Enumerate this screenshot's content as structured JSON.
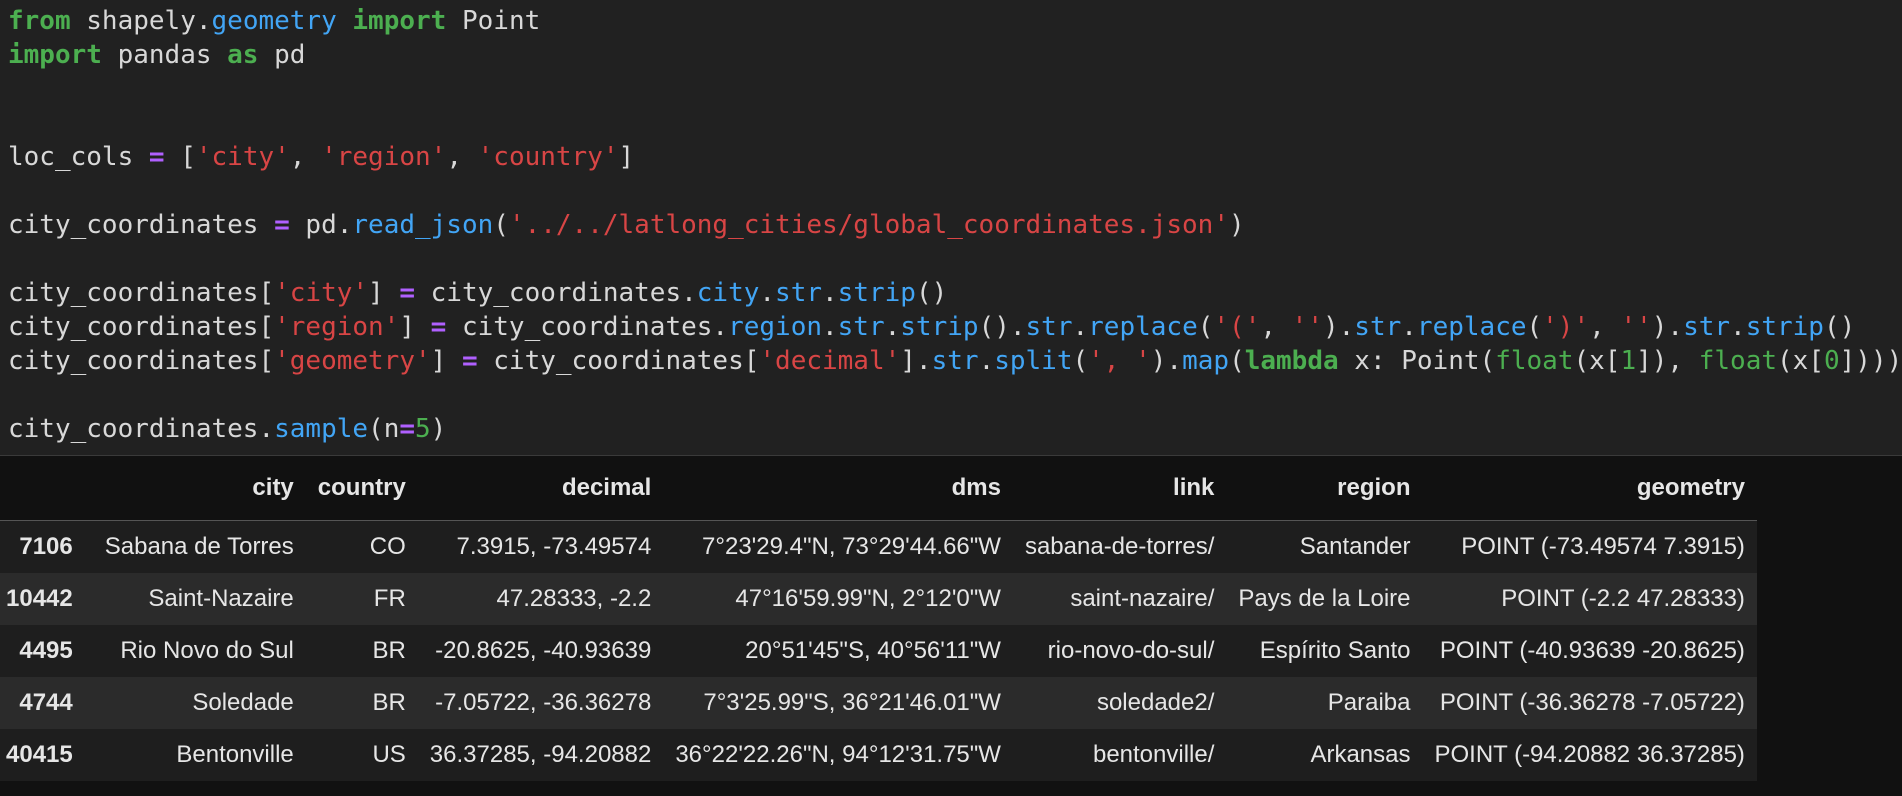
{
  "code": {
    "line1": {
      "kw1": "from",
      "mod": "shapely",
      "dot": ".",
      "attr": "geometry",
      "kw2": "import",
      "name": "Point"
    },
    "line2": {
      "kw1": "import",
      "mod": "pandas",
      "kw2": "as",
      "alias": "pd"
    },
    "line3": {
      "var": "loc_cols",
      "op": "=",
      "open": "[",
      "s1": "'city'",
      "c1": ", ",
      "s2": "'region'",
      "c2": ", ",
      "s3": "'country'",
      "close": "]"
    },
    "line4": {
      "var": "city_coordinates",
      "op": "=",
      "obj": "pd",
      "fn": "read_json",
      "arg": "'../../latlong_cities/global_coordinates.json'"
    },
    "line5": {
      "var": "city_coordinates",
      "key": "'city'",
      "op": "=",
      "rhs_obj": "city_coordinates",
      "a1": "city",
      "a2": "str",
      "a3": "strip"
    },
    "line6": {
      "var": "city_coordinates",
      "key": "'region'",
      "op": "=",
      "rhs_obj": "city_coordinates",
      "a1": "region",
      "a2": "str",
      "a3": "strip",
      "a4": "str",
      "a5": "replace",
      "s1": "'('",
      "s2": "''",
      "a6": "str",
      "a7": "replace",
      "s3": "')'",
      "s4": "''",
      "a8": "str",
      "a9": "strip"
    },
    "line7": {
      "var": "city_coordinates",
      "key": "'geometry'",
      "op": "=",
      "rhs_obj": "city_coordinates",
      "key2": "'decimal'",
      "a1": "str",
      "a2": "split",
      "s1": "', '",
      "a3": "map",
      "kw": "lambda",
      "param": "x",
      "cls": "Point",
      "bi": "float",
      "idx1": "1",
      "idx0": "0"
    },
    "line8": {
      "var": "city_coordinates",
      "fn": "sample",
      "param": "n",
      "op": "=",
      "num": "5"
    }
  },
  "table": {
    "columns": [
      "city",
      "country",
      "decimal",
      "dms",
      "link",
      "region",
      "geometry"
    ],
    "rows": [
      {
        "index": "7106",
        "cells": [
          "Sabana de Torres",
          "CO",
          "7.3915, -73.49574",
          "7°23'29.4\"N, 73°29'44.66\"W",
          "sabana-de-torres/",
          "Santander",
          "POINT (-73.49574 7.3915)"
        ]
      },
      {
        "index": "10442",
        "cells": [
          "Saint-Nazaire",
          "FR",
          "47.28333, -2.2",
          "47°16'59.99\"N, 2°12'0\"W",
          "saint-nazaire/",
          "Pays de la Loire",
          "POINT (-2.2 47.28333)"
        ]
      },
      {
        "index": "4495",
        "cells": [
          "Rio Novo do Sul",
          "BR",
          "-20.8625, -40.93639",
          "20°51'45\"S, 40°56'11\"W",
          "rio-novo-do-sul/",
          "Espírito Santo",
          "POINT (-40.93639 -20.8625)"
        ]
      },
      {
        "index": "4744",
        "cells": [
          "Soledade",
          "BR",
          "-7.05722, -36.36278",
          "7°3'25.99\"S, 36°21'46.01\"W",
          "soledade2/",
          "Paraiba",
          "POINT (-36.36278 -7.05722)"
        ]
      },
      {
        "index": "40415",
        "cells": [
          "Bentonville",
          "US",
          "36.37285, -94.20882",
          "36°22'22.26\"N, 94°12'31.75\"W",
          "bentonville/",
          "Arkansas",
          "POINT (-94.20882 36.37285)"
        ]
      }
    ]
  }
}
